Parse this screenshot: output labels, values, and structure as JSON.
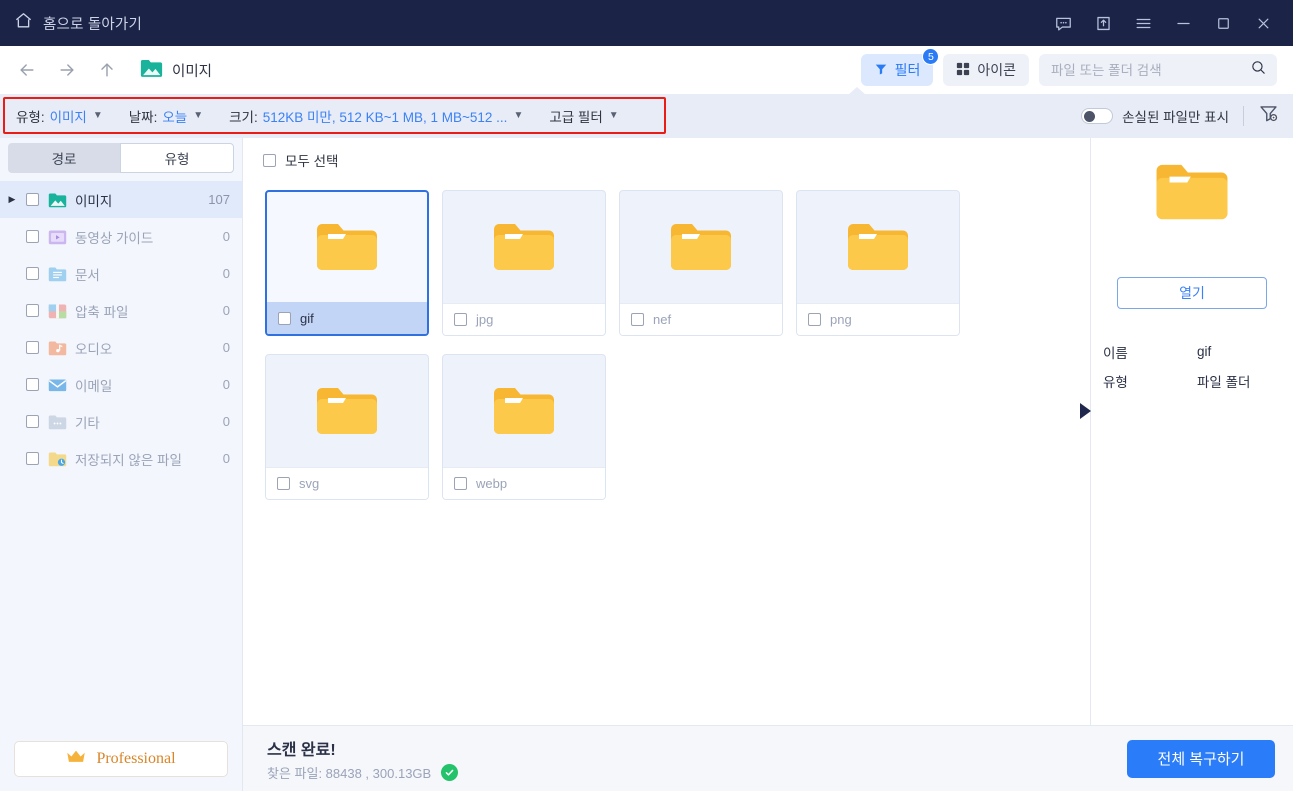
{
  "titlebar": {
    "home_label": "홈으로 돌아가기",
    "home_icon": "home-icon",
    "buttons": [
      {
        "name": "feedback-icon",
        "label": "피드백"
      },
      {
        "name": "share-upload-icon",
        "label": "업로드"
      },
      {
        "name": "hamburger-menu-icon",
        "label": "메뉴"
      },
      {
        "name": "minimize-icon",
        "label": "최소화"
      },
      {
        "name": "maximize-icon",
        "label": "최대화"
      },
      {
        "name": "close-icon",
        "label": "닫기"
      }
    ]
  },
  "navbar": {
    "back_icon": "arrow-left-icon",
    "forward_icon": "arrow-right-icon",
    "up_icon": "arrow-up-icon",
    "breadcrumb_label": "이미지",
    "filter_label": "필터",
    "filter_badge": "5",
    "view_label": "아이콘",
    "search_placeholder": "파일 또는 폴더 검색",
    "search_value": ""
  },
  "filterbar": {
    "items": [
      {
        "label": "유형:",
        "value": "이미지"
      },
      {
        "label": "날짜:",
        "value": "오늘"
      },
      {
        "label": "크기:",
        "value": "512KB 미만, 512 KB~1 MB, 1 MB~512 ..."
      },
      {
        "label": "고급 필터",
        "value": ""
      }
    ],
    "toggle_label": "손실된 파일만 표시",
    "toggle_on": false,
    "reset_icon": "filter-reset-icon",
    "highlight_color": "#ea1c16"
  },
  "sidebar": {
    "tabs": [
      {
        "label": "경로",
        "active": false
      },
      {
        "label": "유형",
        "active": true
      }
    ],
    "items": [
      {
        "label": "이미지",
        "count": "107",
        "icon": "image-folder-icon",
        "selected": true,
        "expandable": true
      },
      {
        "label": "동영상 가이드",
        "count": "0",
        "icon": "video-folder-icon",
        "selected": false,
        "expandable": false
      },
      {
        "label": "문서",
        "count": "0",
        "icon": "document-folder-icon",
        "selected": false,
        "expandable": false
      },
      {
        "label": "압축 파일",
        "count": "0",
        "icon": "archive-folder-icon",
        "selected": false,
        "expandable": false
      },
      {
        "label": "오디오",
        "count": "0",
        "icon": "audio-folder-icon",
        "selected": false,
        "expandable": false
      },
      {
        "label": "이메일",
        "count": "0",
        "icon": "email-icon",
        "selected": false,
        "expandable": false
      },
      {
        "label": "기타",
        "count": "0",
        "icon": "other-folder-icon",
        "selected": false,
        "expandable": false
      },
      {
        "label": "저장되지 않은 파일",
        "count": "0",
        "icon": "unsaved-folder-icon",
        "selected": false,
        "expandable": false
      }
    ],
    "pro_label": "Professional",
    "pro_icon": "crown-icon"
  },
  "files": {
    "select_all_label": "모두 선택",
    "tiles": [
      {
        "name": "gif",
        "selected": true
      },
      {
        "name": "jpg",
        "selected": false
      },
      {
        "name": "nef",
        "selected": false
      },
      {
        "name": "png",
        "selected": false
      },
      {
        "name": "svg",
        "selected": false
      },
      {
        "name": "webp",
        "selected": false
      }
    ]
  },
  "preview": {
    "icon": "folder-icon",
    "open_label": "열기",
    "props": [
      {
        "key": "이름",
        "value": "gif"
      },
      {
        "key": "유형",
        "value": "파일 폴더"
      }
    ],
    "collapse_icon": "collapse-panel-arrow-icon"
  },
  "footer": {
    "status_title": "스캔 완료!",
    "status_sub": "찾은 파일: 88438 , 300.13GB",
    "status_icon": "success-check-icon",
    "recover_label": "전체 복구하기",
    "accent_color": "#2b7cf8"
  }
}
